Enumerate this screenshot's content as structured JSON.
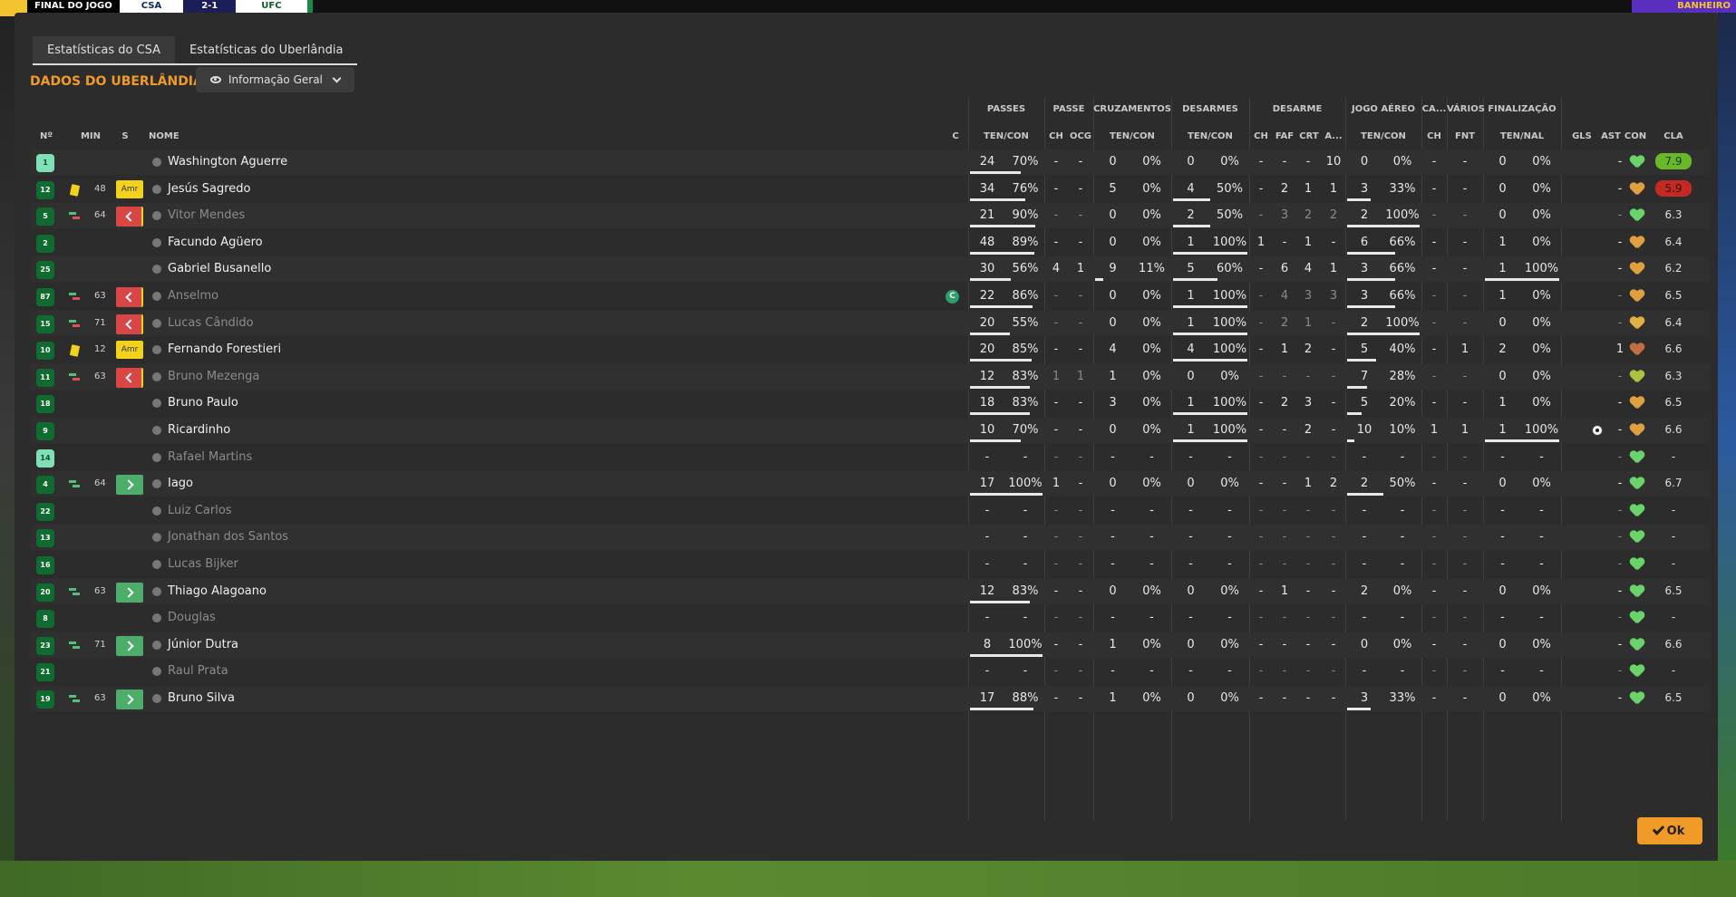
{
  "scorebug": {
    "final_label": "FINAL DO JOGO",
    "home": "CSA",
    "score": "2-1",
    "away": "UFC",
    "right_label": "BANHEIRO"
  },
  "tabs": [
    {
      "label": "Estatísticas do CSA"
    },
    {
      "label": "Estatísticas do Uberlândia"
    }
  ],
  "section_title": "DADOS DO UBERLÂNDIA",
  "view_select": {
    "label": "Informação Geral"
  },
  "group_headers": {
    "passes": "PASSES",
    "passe": "PASSE",
    "cruzamentos": "CRUZAMENTOS",
    "desarmes": "DESARMES",
    "desarme": "DESARME",
    "jogo_aereo": "JOGO AÉREO",
    "ca": "CA...",
    "varios": "VÁRIOS",
    "finalizacao": "FINALIZAÇÃO"
  },
  "col_headers": {
    "no": "Nº",
    "min": "MIN",
    "s": "S",
    "nome": "NOME",
    "c": "C",
    "passes_tc": "TEN/CON",
    "passe_ch": "CH",
    "passe_ocg": "OCG",
    "cruz_tc": "TEN/CON",
    "desarmes_tc": "TEN/CON",
    "des_ch": "CH",
    "des_faf": "FAF",
    "des_crt": "CRT",
    "des_a": "A...",
    "aereo_tc": "TEN/CON",
    "ca_ch": "CH",
    "fnt": "FNT",
    "fin_tn": "TEN/NAL",
    "gls": "GLS",
    "ast": "AST",
    "con": "CON",
    "cla": "CLA"
  },
  "players": [
    {
      "no": "1",
      "gk": true,
      "min": "",
      "card": false,
      "sub": "",
      "s": "",
      "name": "Washington Aguerre",
      "dim": false,
      "cap": false,
      "p": [
        "24",
        "70%"
      ],
      "pbar": 0.7,
      "ch": "-",
      "ocg": "-",
      "cr": [
        "0",
        "0%"
      ],
      "crbar": 0,
      "de": [
        "0",
        "0%"
      ],
      "debar": 0,
      "d": [
        "-",
        "-",
        "-",
        "10"
      ],
      "ae": [
        "0",
        "0%"
      ],
      "aebar": 0,
      "cach": "-",
      "fnt": "-",
      "fin": [
        "0",
        "0%"
      ],
      "finbar": 0,
      "gls": "",
      "goal": false,
      "ast": "-",
      "con": "#6ad46a",
      "cla": "7.9",
      "clacls": "good"
    },
    {
      "no": "12",
      "gk": false,
      "min": "48",
      "card": true,
      "sub": "",
      "s": "amr",
      "name": "Jesús Sagredo",
      "dim": false,
      "cap": false,
      "p": [
        "34",
        "76%"
      ],
      "pbar": 0.76,
      "ch": "-",
      "ocg": "-",
      "cr": [
        "5",
        "0%"
      ],
      "crbar": 0,
      "de": [
        "4",
        "50%"
      ],
      "debar": 0.5,
      "d": [
        "-",
        "2",
        "1",
        "1"
      ],
      "ae": [
        "3",
        "33%"
      ],
      "aebar": 0.33,
      "cach": "-",
      "fnt": "-",
      "fin": [
        "0",
        "0%"
      ],
      "finbar": 0,
      "gls": "",
      "goal": false,
      "ast": "-",
      "con": "#e0a040",
      "cla": "5.9",
      "clacls": "bad"
    },
    {
      "no": "5",
      "gk": false,
      "min": "64",
      "card": false,
      "sub": "out",
      "s": "out",
      "name": "Vitor Mendes",
      "dim": true,
      "cap": false,
      "p": [
        "21",
        "90%"
      ],
      "pbar": 0.9,
      "ch": "-",
      "ocg": "-",
      "cr": [
        "0",
        "0%"
      ],
      "crbar": 0,
      "de": [
        "2",
        "50%"
      ],
      "debar": 0.5,
      "d": [
        "-",
        "3",
        "2",
        "2"
      ],
      "ae": [
        "2",
        "100%"
      ],
      "aebar": 1,
      "cach": "-",
      "fnt": "-",
      "fin": [
        "0",
        "0%"
      ],
      "finbar": 0,
      "gls": "",
      "goal": false,
      "ast": "-",
      "con": "#6ad46a",
      "cla": "6.3",
      "clacls": ""
    },
    {
      "no": "2",
      "gk": false,
      "min": "",
      "card": false,
      "sub": "",
      "s": "",
      "name": "Facundo Agüero",
      "dim": false,
      "cap": false,
      "p": [
        "48",
        "89%"
      ],
      "pbar": 0.89,
      "ch": "-",
      "ocg": "-",
      "cr": [
        "0",
        "0%"
      ],
      "crbar": 0,
      "de": [
        "1",
        "100%"
      ],
      "debar": 1,
      "d": [
        "1",
        "-",
        "1",
        "-"
      ],
      "ae": [
        "6",
        "66%"
      ],
      "aebar": 0.66,
      "cach": "-",
      "fnt": "-",
      "fin": [
        "1",
        "0%"
      ],
      "finbar": 0,
      "gls": "",
      "goal": false,
      "ast": "-",
      "con": "#e0a040",
      "cla": "6.4",
      "clacls": ""
    },
    {
      "no": "25",
      "gk": false,
      "min": "",
      "card": false,
      "sub": "",
      "s": "",
      "name": "Gabriel Busanello",
      "dim": false,
      "cap": false,
      "p": [
        "30",
        "56%"
      ],
      "pbar": 0.56,
      "ch": "4",
      "ocg": "1",
      "cr": [
        "9",
        "11%"
      ],
      "crbar": 0.11,
      "de": [
        "5",
        "60%"
      ],
      "debar": 0.6,
      "d": [
        "-",
        "6",
        "4",
        "1"
      ],
      "ae": [
        "3",
        "66%"
      ],
      "aebar": 0.66,
      "cach": "-",
      "fnt": "-",
      "fin": [
        "1",
        "100%"
      ],
      "finbar": 1,
      "gls": "",
      "goal": false,
      "ast": "-",
      "con": "#e0a040",
      "cla": "6.2",
      "clacls": ""
    },
    {
      "no": "87",
      "gk": false,
      "min": "63",
      "card": false,
      "sub": "out",
      "s": "out",
      "name": "Anselmo",
      "dim": true,
      "cap": true,
      "p": [
        "22",
        "86%"
      ],
      "pbar": 0.86,
      "ch": "-",
      "ocg": "-",
      "cr": [
        "0",
        "0%"
      ],
      "crbar": 0,
      "de": [
        "1",
        "100%"
      ],
      "debar": 1,
      "d": [
        "-",
        "4",
        "3",
        "3"
      ],
      "ae": [
        "3",
        "66%"
      ],
      "aebar": 0.66,
      "cach": "-",
      "fnt": "-",
      "fin": [
        "1",
        "0%"
      ],
      "finbar": 0,
      "gls": "",
      "goal": false,
      "ast": "-",
      "con": "#e0a040",
      "cla": "6.5",
      "clacls": ""
    },
    {
      "no": "15",
      "gk": false,
      "min": "71",
      "card": false,
      "sub": "out",
      "s": "out",
      "name": "Lucas Cândido",
      "dim": true,
      "cap": false,
      "p": [
        "20",
        "55%"
      ],
      "pbar": 0.55,
      "ch": "-",
      "ocg": "-",
      "cr": [
        "0",
        "0%"
      ],
      "crbar": 0,
      "de": [
        "1",
        "100%"
      ],
      "debar": 1,
      "d": [
        "-",
        "2",
        "1",
        "-"
      ],
      "ae": [
        "2",
        "100%"
      ],
      "aebar": 1,
      "cach": "-",
      "fnt": "-",
      "fin": [
        "0",
        "0%"
      ],
      "finbar": 0,
      "gls": "",
      "goal": false,
      "ast": "-",
      "con": "#e0b040",
      "cla": "6.4",
      "clacls": ""
    },
    {
      "no": "10",
      "gk": false,
      "min": "12",
      "card": true,
      "sub": "",
      "s": "amr",
      "name": "Fernando Forestieri",
      "dim": false,
      "cap": false,
      "p": [
        "20",
        "85%"
      ],
      "pbar": 0.85,
      "ch": "-",
      "ocg": "-",
      "cr": [
        "4",
        "0%"
      ],
      "crbar": 0,
      "de": [
        "4",
        "100%"
      ],
      "debar": 1,
      "d": [
        "-",
        "1",
        "2",
        "-"
      ],
      "ae": [
        "5",
        "40%"
      ],
      "aebar": 0.4,
      "cach": "-",
      "fnt": "1",
      "fin": [
        "2",
        "0%"
      ],
      "finbar": 0,
      "gls": "",
      "goal": false,
      "ast": "1",
      "con": "#c07040",
      "cla": "6.6",
      "clacls": ""
    },
    {
      "no": "11",
      "gk": false,
      "min": "63",
      "card": false,
      "sub": "out",
      "s": "out",
      "name": "Bruno Mezenga",
      "dim": true,
      "cap": false,
      "p": [
        "12",
        "83%"
      ],
      "pbar": 0.83,
      "ch": "1",
      "ocg": "1",
      "cr": [
        "1",
        "0%"
      ],
      "crbar": 0,
      "de": [
        "0",
        "0%"
      ],
      "debar": 0,
      "d": [
        "-",
        "-",
        "-",
        "-"
      ],
      "ae": [
        "7",
        "28%"
      ],
      "aebar": 0.28,
      "cach": "-",
      "fnt": "-",
      "fin": [
        "0",
        "0%"
      ],
      "finbar": 0,
      "gls": "",
      "goal": false,
      "ast": "-",
      "con": "#b0c040",
      "cla": "6.3",
      "clacls": ""
    },
    {
      "no": "18",
      "gk": false,
      "min": "",
      "card": false,
      "sub": "",
      "s": "",
      "name": "Bruno Paulo",
      "dim": false,
      "cap": false,
      "p": [
        "18",
        "83%"
      ],
      "pbar": 0.83,
      "ch": "-",
      "ocg": "-",
      "cr": [
        "3",
        "0%"
      ],
      "crbar": 0,
      "de": [
        "1",
        "100%"
      ],
      "debar": 1,
      "d": [
        "-",
        "2",
        "3",
        "-"
      ],
      "ae": [
        "5",
        "20%"
      ],
      "aebar": 0.2,
      "cach": "-",
      "fnt": "-",
      "fin": [
        "1",
        "0%"
      ],
      "finbar": 0,
      "gls": "",
      "goal": false,
      "ast": "-",
      "con": "#e0a040",
      "cla": "6.5",
      "clacls": ""
    },
    {
      "no": "9",
      "gk": false,
      "min": "",
      "card": false,
      "sub": "",
      "s": "",
      "name": "Ricardinho",
      "dim": false,
      "cap": false,
      "p": [
        "10",
        "70%"
      ],
      "pbar": 0.7,
      "ch": "-",
      "ocg": "-",
      "cr": [
        "0",
        "0%"
      ],
      "crbar": 0,
      "de": [
        "1",
        "100%"
      ],
      "debar": 1,
      "d": [
        "-",
        "-",
        "2",
        "-"
      ],
      "ae": [
        "10",
        "10%"
      ],
      "aebar": 0.1,
      "cach": "1",
      "fnt": "1",
      "fin": [
        "1",
        "100%"
      ],
      "finbar": 1,
      "gls": "",
      "goal": true,
      "ast": "-",
      "con": "#e0a040",
      "cla": "6.6",
      "clacls": ""
    },
    {
      "no": "14",
      "gk": true,
      "min": "",
      "card": false,
      "sub": "",
      "s": "",
      "name": "Rafael Martins",
      "dim": true,
      "cap": false,
      "p": [
        "-",
        "-"
      ],
      "pbar": 0,
      "ch": "-",
      "ocg": "-",
      "cr": [
        "-",
        "-"
      ],
      "crbar": 0,
      "de": [
        "-",
        "-"
      ],
      "debar": 0,
      "d": [
        "-",
        "-",
        "-",
        "-"
      ],
      "ae": [
        "-",
        "-"
      ],
      "aebar": 0,
      "cach": "-",
      "fnt": "-",
      "fin": [
        "-",
        "-"
      ],
      "finbar": 0,
      "gls": "",
      "goal": false,
      "ast": "-",
      "con": "#6ad46a",
      "cla": "-",
      "clacls": ""
    },
    {
      "no": "4",
      "gk": false,
      "min": "64",
      "card": false,
      "sub": "in",
      "s": "in",
      "name": "Iago",
      "dim": false,
      "cap": false,
      "p": [
        "17",
        "100%"
      ],
      "pbar": 1,
      "ch": "1",
      "ocg": "-",
      "cr": [
        "0",
        "0%"
      ],
      "crbar": 0,
      "de": [
        "0",
        "0%"
      ],
      "debar": 0,
      "d": [
        "-",
        "-",
        "1",
        "2"
      ],
      "ae": [
        "2",
        "50%"
      ],
      "aebar": 0.5,
      "cach": "-",
      "fnt": "-",
      "fin": [
        "0",
        "0%"
      ],
      "finbar": 0,
      "gls": "",
      "goal": false,
      "ast": "-",
      "con": "#6ad46a",
      "cla": "6.7",
      "clacls": ""
    },
    {
      "no": "22",
      "gk": false,
      "min": "",
      "card": false,
      "sub": "",
      "s": "",
      "name": "Luiz Carlos",
      "dim": true,
      "cap": false,
      "p": [
        "-",
        "-"
      ],
      "pbar": 0,
      "ch": "-",
      "ocg": "-",
      "cr": [
        "-",
        "-"
      ],
      "crbar": 0,
      "de": [
        "-",
        "-"
      ],
      "debar": 0,
      "d": [
        "-",
        "-",
        "-",
        "-"
      ],
      "ae": [
        "-",
        "-"
      ],
      "aebar": 0,
      "cach": "-",
      "fnt": "-",
      "fin": [
        "-",
        "-"
      ],
      "finbar": 0,
      "gls": "",
      "goal": false,
      "ast": "-",
      "con": "#6ad46a",
      "cla": "-",
      "clacls": ""
    },
    {
      "no": "13",
      "gk": false,
      "min": "",
      "card": false,
      "sub": "",
      "s": "",
      "name": "Jonathan dos Santos",
      "dim": true,
      "cap": false,
      "p": [
        "-",
        "-"
      ],
      "pbar": 0,
      "ch": "-",
      "ocg": "-",
      "cr": [
        "-",
        "-"
      ],
      "crbar": 0,
      "de": [
        "-",
        "-"
      ],
      "debar": 0,
      "d": [
        "-",
        "-",
        "-",
        "-"
      ],
      "ae": [
        "-",
        "-"
      ],
      "aebar": 0,
      "cach": "-",
      "fnt": "-",
      "fin": [
        "-",
        "-"
      ],
      "finbar": 0,
      "gls": "",
      "goal": false,
      "ast": "-",
      "con": "#6ad46a",
      "cla": "-",
      "clacls": ""
    },
    {
      "no": "16",
      "gk": false,
      "min": "",
      "card": false,
      "sub": "",
      "s": "",
      "name": "Lucas Bijker",
      "dim": true,
      "cap": false,
      "p": [
        "-",
        "-"
      ],
      "pbar": 0,
      "ch": "-",
      "ocg": "-",
      "cr": [
        "-",
        "-"
      ],
      "crbar": 0,
      "de": [
        "-",
        "-"
      ],
      "debar": 0,
      "d": [
        "-",
        "-",
        "-",
        "-"
      ],
      "ae": [
        "-",
        "-"
      ],
      "aebar": 0,
      "cach": "-",
      "fnt": "-",
      "fin": [
        "-",
        "-"
      ],
      "finbar": 0,
      "gls": "",
      "goal": false,
      "ast": "-",
      "con": "#6ad46a",
      "cla": "-",
      "clacls": ""
    },
    {
      "no": "20",
      "gk": false,
      "min": "63",
      "card": false,
      "sub": "in",
      "s": "in",
      "name": "Thiago Alagoano",
      "dim": false,
      "cap": false,
      "p": [
        "12",
        "83%"
      ],
      "pbar": 0.83,
      "ch": "-",
      "ocg": "-",
      "cr": [
        "0",
        "0%"
      ],
      "crbar": 0,
      "de": [
        "0",
        "0%"
      ],
      "debar": 0,
      "d": [
        "-",
        "1",
        "-",
        "-"
      ],
      "ae": [
        "2",
        "0%"
      ],
      "aebar": 0,
      "cach": "-",
      "fnt": "-",
      "fin": [
        "0",
        "0%"
      ],
      "finbar": 0,
      "gls": "",
      "goal": false,
      "ast": "-",
      "con": "#6ad46a",
      "cla": "6.5",
      "clacls": ""
    },
    {
      "no": "8",
      "gk": false,
      "min": "",
      "card": false,
      "sub": "",
      "s": "",
      "name": "Douglas",
      "dim": true,
      "cap": false,
      "p": [
        "-",
        "-"
      ],
      "pbar": 0,
      "ch": "-",
      "ocg": "-",
      "cr": [
        "-",
        "-"
      ],
      "crbar": 0,
      "de": [
        "-",
        "-"
      ],
      "debar": 0,
      "d": [
        "-",
        "-",
        "-",
        "-"
      ],
      "ae": [
        "-",
        "-"
      ],
      "aebar": 0,
      "cach": "-",
      "fnt": "-",
      "fin": [
        "-",
        "-"
      ],
      "finbar": 0,
      "gls": "",
      "goal": false,
      "ast": "-",
      "con": "#6ad46a",
      "cla": "-",
      "clacls": ""
    },
    {
      "no": "23",
      "gk": false,
      "min": "71",
      "card": false,
      "sub": "in",
      "s": "in",
      "name": "Júnior Dutra",
      "dim": false,
      "cap": false,
      "p": [
        "8",
        "100%"
      ],
      "pbar": 1,
      "ch": "-",
      "ocg": "-",
      "cr": [
        "1",
        "0%"
      ],
      "crbar": 0,
      "de": [
        "0",
        "0%"
      ],
      "debar": 0,
      "d": [
        "-",
        "-",
        "-",
        "-"
      ],
      "ae": [
        "0",
        "0%"
      ],
      "aebar": 0,
      "cach": "-",
      "fnt": "-",
      "fin": [
        "0",
        "0%"
      ],
      "finbar": 0,
      "gls": "",
      "goal": false,
      "ast": "-",
      "con": "#6ad46a",
      "cla": "6.6",
      "clacls": ""
    },
    {
      "no": "21",
      "gk": false,
      "min": "",
      "card": false,
      "sub": "",
      "s": "",
      "name": "Raul Prata",
      "dim": true,
      "cap": false,
      "p": [
        "-",
        "-"
      ],
      "pbar": 0,
      "ch": "-",
      "ocg": "-",
      "cr": [
        "-",
        "-"
      ],
      "crbar": 0,
      "de": [
        "-",
        "-"
      ],
      "debar": 0,
      "d": [
        "-",
        "-",
        "-",
        "-"
      ],
      "ae": [
        "-",
        "-"
      ],
      "aebar": 0,
      "cach": "-",
      "fnt": "-",
      "fin": [
        "-",
        "-"
      ],
      "finbar": 0,
      "gls": "",
      "goal": false,
      "ast": "-",
      "con": "#6ad46a",
      "cla": "-",
      "clacls": ""
    },
    {
      "no": "19",
      "gk": false,
      "min": "63",
      "card": false,
      "sub": "in",
      "s": "in",
      "name": "Bruno Silva",
      "dim": false,
      "cap": false,
      "p": [
        "17",
        "88%"
      ],
      "pbar": 0.88,
      "ch": "-",
      "ocg": "-",
      "cr": [
        "1",
        "0%"
      ],
      "crbar": 0,
      "de": [
        "0",
        "0%"
      ],
      "debar": 0,
      "d": [
        "-",
        "-",
        "-",
        "-"
      ],
      "ae": [
        "3",
        "33%"
      ],
      "aebar": 0.33,
      "cach": "-",
      "fnt": "-",
      "fin": [
        "0",
        "0%"
      ],
      "finbar": 0,
      "gls": "",
      "goal": false,
      "ast": "-",
      "con": "#6ad46a",
      "cla": "6.5",
      "clacls": ""
    }
  ],
  "sub_badge_labels": {
    "amr": "Amr"
  },
  "captain_label": "C",
  "ok_button": {
    "label": "Ok"
  }
}
